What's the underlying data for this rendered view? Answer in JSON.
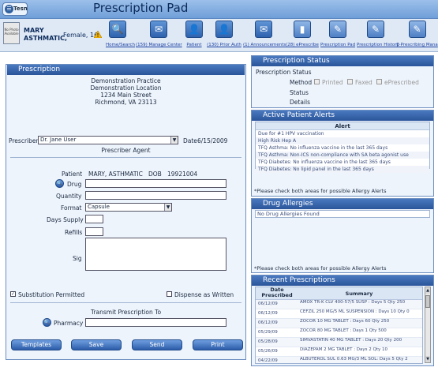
{
  "header": {
    "title": "Prescription Pad",
    "logo_text": "Tesn",
    "logo_glyph": "☰"
  },
  "patient": {
    "photo_text": "No Photo Available",
    "first_name_line": "MARY",
    "last_name_line": "ASTHMATIC,",
    "gender_age": "Female, 16"
  },
  "toolbar": {
    "items": [
      {
        "label": "Home/Search",
        "icon": "magnifier-icon",
        "glyph": "🔍"
      },
      {
        "label": "(159) Manage Center",
        "icon": "envelope-icon",
        "glyph": "✉"
      },
      {
        "label": "Patient",
        "icon": "person-icon",
        "glyph": "👤"
      },
      {
        "label": "(130) Prior Auth",
        "icon": "person-icon",
        "glyph": "👤"
      },
      {
        "label": "(1) Announcements",
        "icon": "envelope-icon",
        "glyph": "✉"
      },
      {
        "label": "(28) ePrescribe",
        "icon": "pill-bottle-icon",
        "glyph": "▮"
      },
      {
        "label": "Prescription Pad",
        "icon": "notepad-icon",
        "glyph": "✎"
      },
      {
        "label": "Prescription History",
        "icon": "notepad-icon",
        "glyph": "✎"
      },
      {
        "label": "E-Prescribing Mana",
        "icon": "notepad-icon",
        "glyph": "✎"
      }
    ]
  },
  "prescription": {
    "panel_title": "Prescription",
    "practice_name": "Demonstration Practice",
    "practice_location": "Demonstration Location",
    "address1": "1234 Main Street",
    "address2": "Richmond, VA 23113",
    "prescriber_label": "Prescriber",
    "prescriber_value": "Dr. Jane User",
    "date_label": "Date",
    "date_value": "6/15/2009",
    "prescriber_agent": "Prescriber Agent",
    "patient_label": "Patient",
    "patient_value": "MARY, ASTHMATIC",
    "dob_label": "DOB",
    "dob_value": "19921004",
    "drug_label": "Drug",
    "drug_value": "",
    "quantity_label": "Quantity",
    "quantity_value": "",
    "format_label": "Format",
    "format_value": "Capsule",
    "days_supply_label": "Days Supply",
    "days_supply_value": "",
    "refills_label": "Refills",
    "refills_value": "",
    "sig_label": "Sig",
    "sig_value": "",
    "substitution_label": "Substitution Permitted",
    "substitution_checked": "✓",
    "dispense_label": "Dispense as Written",
    "transmit_label": "Transmit Prescription To",
    "pharmacy_label": "Pharmacy",
    "pharmacy_value": "",
    "buttons": {
      "templates": "Templates",
      "save": "Save",
      "send": "Send",
      "print": "Print"
    }
  },
  "status": {
    "panel_title": "Prescription Status",
    "heading": "Prescription Status",
    "method_label": "Method",
    "printed": "Printed",
    "faxed": "Faxed",
    "eprescribed": "ePrescribed",
    "status_label": "Status",
    "details_label": "Details"
  },
  "alerts": {
    "panel_title": "Active Patient Alerts",
    "column": "Alert",
    "rows": [
      "Due for #1 HPV vaccination",
      "High Risk Hep A",
      "TFQ Asthma: No influenza vaccine in the last 365 days",
      "TFQ Asthma: Non-ICS non-compliance with SA beta agonist use",
      "TFQ Diabetes: No influenza vaccine in the last 365 days",
      "TFQ Diabetes: No lipid panel in the last 365 days"
    ],
    "note": "*Please check both areas for possible Allergy Alerts"
  },
  "drug_allergies": {
    "panel_title": "Drug Allergies",
    "value": "No Drug Allergies Found",
    "note": "*Please check both areas for possible Allergy Alerts"
  },
  "recent": {
    "panel_title": "Recent Prescriptions",
    "col_date": "Date Prescribed",
    "col_summary": "Summary",
    "rows": [
      {
        "date": "06/12/09",
        "summary": "AMOX TR-K CLV 400-57/5 SUSP : Days 5 Qty 250"
      },
      {
        "date": "06/12/09",
        "summary": "CEFZIL 250 MG/5 ML SUSPENSION : Days 10 Qty 0"
      },
      {
        "date": "06/12/09",
        "summary": "ZOCOR 10 MG TABLET : Days 60 Qty 250"
      },
      {
        "date": "05/29/09",
        "summary": "ZOCOR 80 MG TABLET : Days 1 Qty 500"
      },
      {
        "date": "05/28/09",
        "summary": "SIMVASTATIN 40 MG TABLET : Days 20 Qty 200"
      },
      {
        "date": "05/26/09",
        "summary": "DIAZEPAM 2 MG TABLET : Days 2 Qty 10"
      },
      {
        "date": "04/22/09",
        "summary": "ALBUTEROL SUL 0.63 MG/3 ML SOL: Days 5 Qty 2"
      }
    ]
  },
  "colors": {
    "accent": "#2a559a",
    "title_bar": "#6f9fd8",
    "panel_bg": "#eef4fc",
    "link": "#1a3fa0"
  }
}
